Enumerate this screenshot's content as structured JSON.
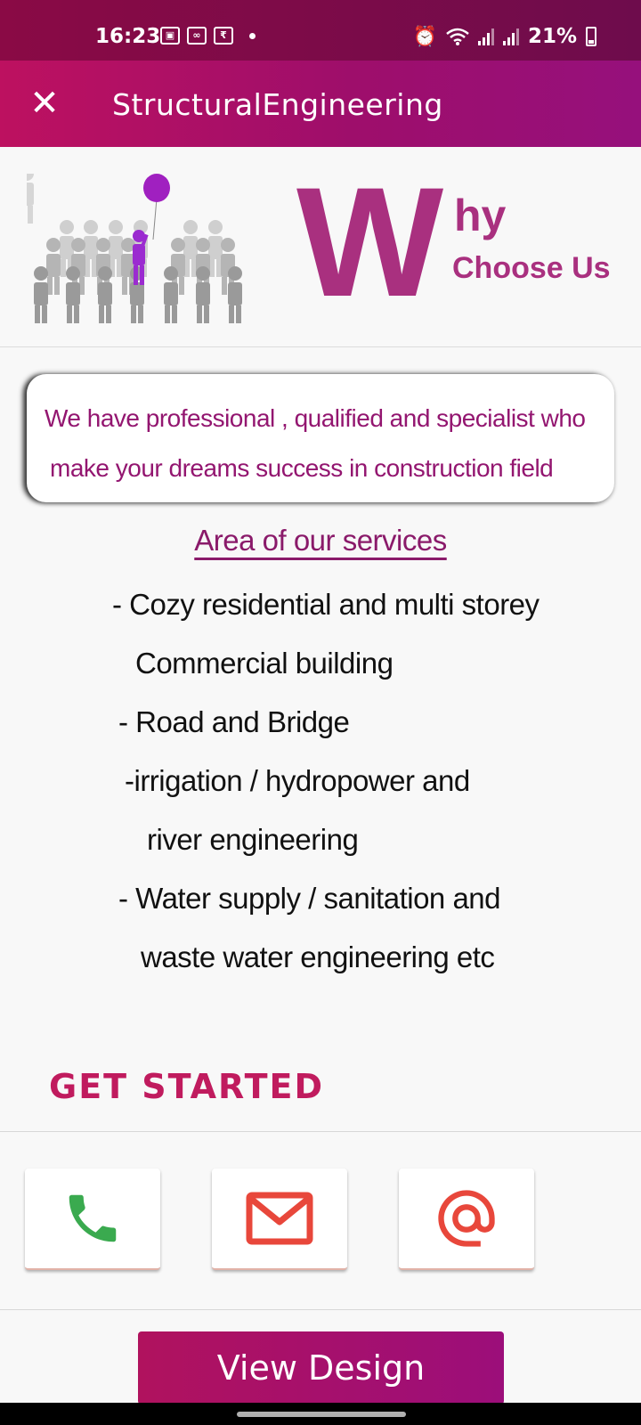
{
  "status_bar": {
    "time": "16:23",
    "battery": "21%",
    "icons": [
      "gallery-icon",
      "voicemail-icon",
      "rupee-icon",
      "alarm-icon",
      "wifi-icon",
      "signal-icon",
      "battery-icon"
    ]
  },
  "app_bar": {
    "title": "StructuralEngineering",
    "close_icon": "close-icon"
  },
  "hero": {
    "big_letter": "W",
    "hy": "hy",
    "choose_us": "Choose Us"
  },
  "intro": {
    "line1": "We have professional , qualified and specialist who",
    "line2": "make your dreams  success in construction field"
  },
  "services": {
    "heading": "Area of our services ",
    "lines": [
      "- Cozy residential and multi storey",
      "Commercial building",
      "- Road and Bridge",
      "-irrigation  / hydropower and",
      "river engineering",
      "- Water supply / sanitation and",
      "waste water engineering  etc"
    ]
  },
  "get_started": "GET STARTED",
  "contact": {
    "phone_icon": "phone-icon",
    "mail_icon": "mail-icon",
    "at_icon": "at-sign-icon",
    "colors": {
      "phone": "#3aaa4f",
      "mail": "#e8473b",
      "at": "#e8473b"
    }
  },
  "view_design_label": "View Design",
  "colors": {
    "brand": "#a9307f",
    "accent": "#c01b5e"
  }
}
